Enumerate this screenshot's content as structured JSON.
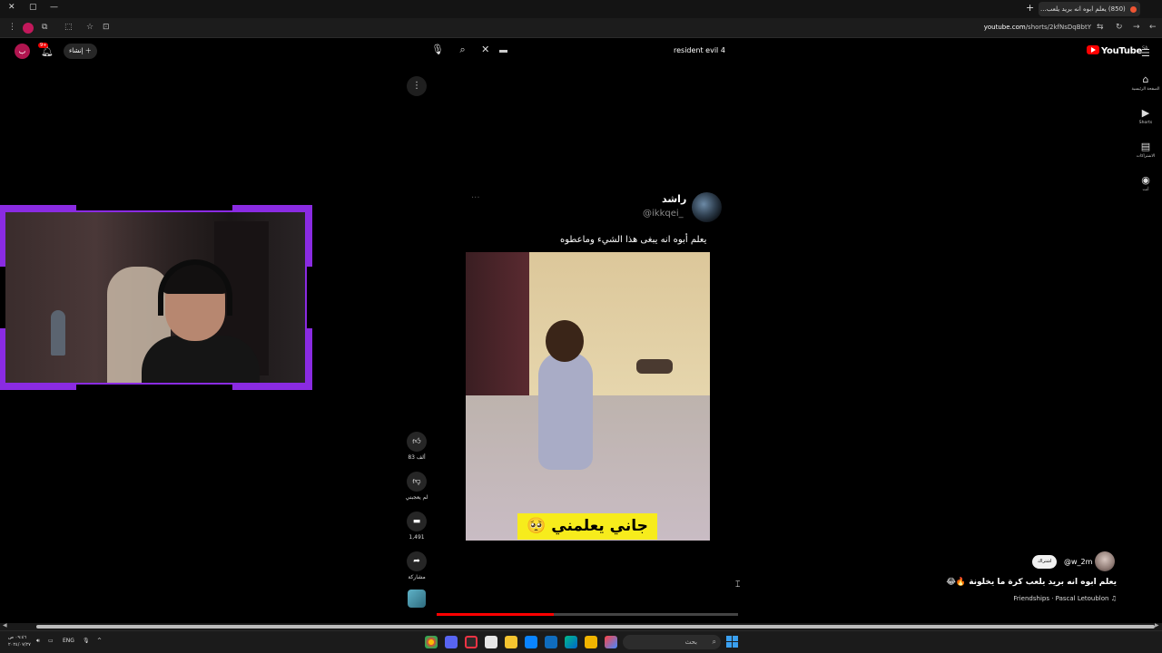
{
  "browser": {
    "tab_title": "(850) يعلم ابوه انه بريد يلعب...",
    "url_host": "youtube.com",
    "url_path": "/shorts/2kfNsDqBbtY",
    "close_label": "✕",
    "new_tab_label": "+"
  },
  "youtube": {
    "logo_text": "YouTube",
    "region": "SA",
    "search_query": "resident evil 4",
    "create_label": "إنشاء",
    "avatar_letter": "ب",
    "notification_count": "9+",
    "guide": [
      {
        "icon": "home-icon",
        "glyph": "⌂",
        "label": "الصفحة الرئيسية"
      },
      {
        "icon": "shorts-icon",
        "glyph": "▶",
        "label": "Shorts"
      },
      {
        "icon": "subscriptions-icon",
        "glyph": "▤",
        "label": "الاشتراكات"
      },
      {
        "icon": "you-icon",
        "glyph": "◉",
        "label": "أنت"
      }
    ]
  },
  "short": {
    "tweet_name": "راشد",
    "tweet_handle": "@ikkqei_",
    "tweet_text": "يعلم أبوه انه يبغى هذا الشيء وماعطوه",
    "caption": "جاني يعلمني 🥺",
    "progress": 0.39,
    "actions": {
      "likes": "83 ألف",
      "dislike_label": "لم يعجبني",
      "comments": "1,491",
      "share_label": "مشاركة"
    },
    "channel_handle": "@w_2m",
    "subscribe_label": "اشتراك",
    "title": "يعلم ابوه انه بريد يلعب كرة ما يخلونة 🔥😂",
    "music": "Friendships · Pascal Letoublon"
  },
  "taskbar": {
    "time": "٠٩:٤٦ ص",
    "date": "٢٠٢٤/٠٧/٢٧",
    "lang": "ENG",
    "search_placeholder": "بحث"
  }
}
